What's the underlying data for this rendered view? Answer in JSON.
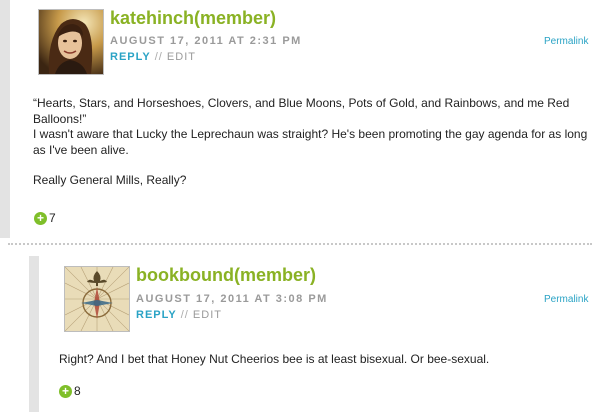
{
  "comments": [
    {
      "author": "katehinch(member)",
      "date": "AUGUST 17, 2011 AT 2:31 PM",
      "reply_label": "REPLY",
      "separator": "//",
      "edit_label": "EDIT",
      "permalink_label": "Permalink",
      "body": [
        "“Hearts, Stars, and Horseshoes, Clovers, and Blue Moons, Pots of Gold, and Rainbows, and me Red Balloons!”\nI wasn't aware that Lucky the Leprechaun was straight? He's been promoting the gay agenda for as long as I've been alive.",
        "Really General Mills, Really?"
      ],
      "votes": "7",
      "avatar_icon": "person-photo-icon"
    },
    {
      "author": "bookbound(member)",
      "date": "AUGUST 17, 2011 AT 3:08 PM",
      "reply_label": "REPLY",
      "separator": "//",
      "edit_label": "EDIT",
      "permalink_label": "Permalink",
      "body": [
        "Right? And I bet that Honey Nut Cheerios bee is at least bisexual. Or bee-sexual."
      ],
      "votes": "8",
      "avatar_icon": "compass-rose-icon"
    }
  ],
  "colors": {
    "author": "#8ab224",
    "link": "#2aa3c5",
    "meta": "#9a9a9a",
    "vote_plus": "#7fbf2a",
    "left_bar": "#e3e3e3"
  }
}
